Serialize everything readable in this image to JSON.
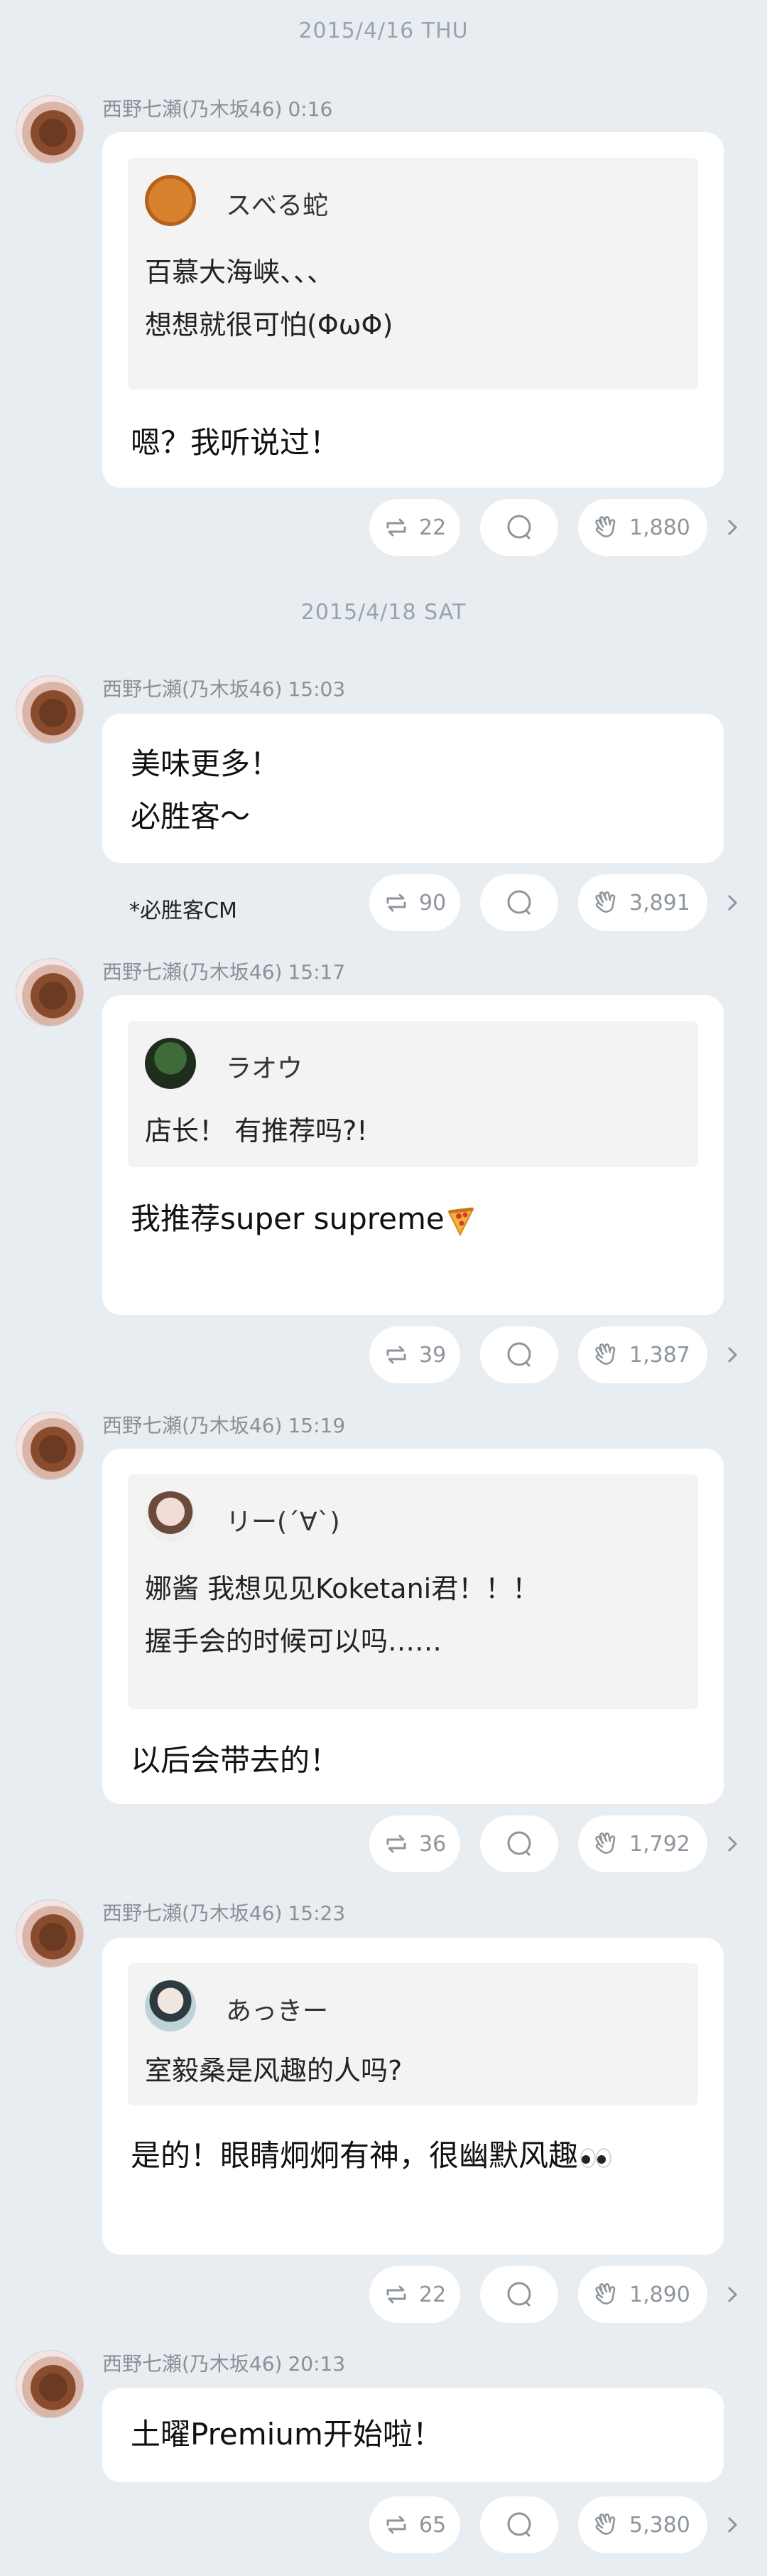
{
  "colors": {
    "background": "#e8edf2",
    "card": "#ffffff",
    "quote": "#f3f3f3",
    "muted": "#8e959c"
  },
  "dates": [
    "2015/4/16 THU",
    "2015/4/18 SAT"
  ],
  "posts": [
    {
      "author": "西野七瀬(乃木坂46)",
      "time": "0:16",
      "quote": {
        "name": "スべる蛇",
        "lines": [
          "百慕大海峡、、、",
          "想想就很可怕(ΦωΦ)"
        ]
      },
      "body": [
        "嗯？我听说过！"
      ],
      "reposts": "22",
      "claps": "1,880"
    },
    {
      "author": "西野七瀬(乃木坂46)",
      "time": "15:03",
      "body": [
        "美味更多！",
        "必胜客～"
      ],
      "note": "*必胜客CM",
      "reposts": "90",
      "claps": "3,891"
    },
    {
      "author": "西野七瀬(乃木坂46)",
      "time": "15:17",
      "quote": {
        "name": "ラオウ",
        "lines": [
          "店长！ 有推荐吗?!"
        ]
      },
      "body": [
        "我推荐super supreme"
      ],
      "reposts": "39",
      "claps": "1,387"
    },
    {
      "author": "西野七瀬(乃木坂46)",
      "time": "15:19",
      "quote": {
        "name": "リー(´∀`)",
        "lines": [
          "娜酱 我想见见Koketani君！！！",
          "握手会的时候可以吗……"
        ]
      },
      "body": [
        "以后会带去的！"
      ],
      "reposts": "36",
      "claps": "1,792"
    },
    {
      "author": "西野七瀬(乃木坂46)",
      "time": "15:23",
      "quote": {
        "name": "あっきー",
        "lines": [
          "室毅桑是风趣的人吗?"
        ]
      },
      "body": [
        "是的！眼睛炯炯有神，很幽默风趣"
      ],
      "reposts": "22",
      "claps": "1,890"
    },
    {
      "author": "西野七瀬(乃木坂46)",
      "time": "20:13",
      "body": [
        "土曜Premium开始啦！"
      ],
      "reposts": "65",
      "claps": "5,380"
    }
  ],
  "icons": {
    "repost": "repost-icon",
    "comment": "comment-icon",
    "clap": "clap-icon",
    "more": "chevron-right-icon"
  }
}
